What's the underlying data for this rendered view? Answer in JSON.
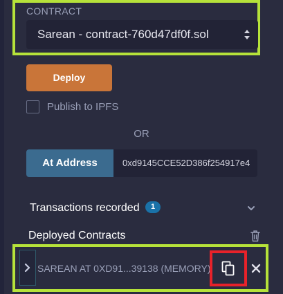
{
  "contract": {
    "label": "CONTRACT",
    "selected": "Sarean - contract-760d47df0f.sol"
  },
  "deploy": {
    "label": "Deploy",
    "color": "#c97539"
  },
  "publish": {
    "label": "Publish to IPFS",
    "checked": false
  },
  "or_text": "OR",
  "at_address": {
    "label": "At Address",
    "input_value": "0xd9145CCE52D386f254917e4",
    "color": "#3b6b8f"
  },
  "transactions": {
    "label": "Transactions recorded",
    "count": "1"
  },
  "deployed": {
    "label": "Deployed Contracts",
    "instance_name": "SAREAN AT 0XD91...39138 (MEMORY)"
  },
  "icons": {
    "select_arrows": "select-arrows-icon",
    "chevron": "chevron-down-icon",
    "trash": "trash-icon",
    "expand": "chevron-right-icon",
    "copy": "copy-icon",
    "close": "close-icon"
  },
  "colors": {
    "background": "#2a2c3f",
    "highlight_green": "#b6e23a",
    "highlight_red": "#e8222a",
    "badge": "#1a72a8"
  }
}
